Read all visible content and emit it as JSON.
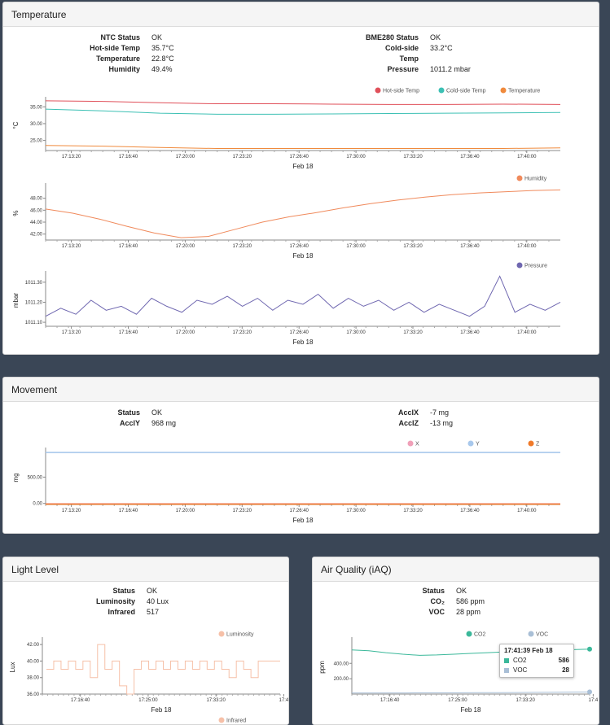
{
  "temperature": {
    "title": "Temperature",
    "status_left": [
      {
        "k": "NTC Status",
        "v": "OK"
      },
      {
        "k": "Hot-side Temp",
        "v": "35.7°C"
      },
      {
        "k": "Temperature",
        "v": "22.8°C"
      },
      {
        "k": "Humidity",
        "v": "49.4%"
      }
    ],
    "status_right": [
      {
        "k": "BME280 Status",
        "v": "OK"
      },
      {
        "k": "Cold-side Temp",
        "v": "33.2°C"
      },
      {
        "k": "Pressure",
        "v": "1011.2 mbar"
      }
    ]
  },
  "movement": {
    "title": "Movement",
    "status_left": [
      {
        "k": "Status",
        "v": "OK"
      },
      {
        "k": "AcclY",
        "v": "968 mg"
      }
    ],
    "status_right": [
      {
        "k": "AcclX",
        "v": "-7 mg"
      },
      {
        "k": "AcclZ",
        "v": "-13 mg"
      }
    ]
  },
  "light": {
    "title": "Light Level",
    "status": [
      {
        "k": "Status",
        "v": "OK"
      },
      {
        "k": "Luminosity",
        "v": "40 Lux"
      },
      {
        "k": "Infrared",
        "v": "517"
      }
    ]
  },
  "air": {
    "title": "Air Quality (iAQ)",
    "status": [
      {
        "k": "Status",
        "v": "OK"
      },
      {
        "k": "CO₂",
        "v": "586 ppm"
      },
      {
        "k": "VOC",
        "v": "28 ppm"
      }
    ],
    "tooltip": {
      "time": "17:41:39  Feb 18",
      "rows": [
        {
          "name": "CO2",
          "value": "586",
          "color": "#3bb89a"
        },
        {
          "name": "VOC",
          "value": "28",
          "color": "#a9bfd6"
        }
      ]
    }
  },
  "chart_data": [
    {
      "id": "temp",
      "type": "line",
      "ylabel": "°C",
      "xlabel": "Feb 18",
      "x": [
        "17:13:20",
        "17:16:40",
        "17:20:00",
        "17:23:20",
        "17:26:40",
        "17:30:00",
        "17:33:20",
        "17:36:40",
        "17:40:00"
      ],
      "yticks": [
        "35.00",
        "30.00",
        "25.00"
      ],
      "ylim": [
        22,
        37
      ],
      "legend": "top-right",
      "series": [
        {
          "name": "Hot-side Temp",
          "color": "#e0505a",
          "values": [
            36.8,
            36.6,
            36.2,
            35.9,
            35.9,
            35.8,
            35.7,
            35.7,
            35.8,
            35.7
          ]
        },
        {
          "name": "Cold-side Temp",
          "color": "#3cc0b4",
          "values": [
            34.3,
            33.8,
            33.1,
            32.8,
            32.8,
            32.9,
            33.0,
            33.1,
            33.2,
            33.3
          ]
        },
        {
          "name": "Temperature",
          "color": "#f08a3c",
          "values": [
            23.5,
            23.3,
            22.9,
            22.6,
            22.6,
            22.6,
            22.6,
            22.6,
            22.6,
            22.8
          ]
        }
      ]
    },
    {
      "id": "hum",
      "type": "line",
      "ylabel": "%",
      "xlabel": "Feb 18",
      "x": [
        "17:13:20",
        "17:16:40",
        "17:20:00",
        "17:23:20",
        "17:26:40",
        "17:30:00",
        "17:33:20",
        "17:36:40",
        "17:40:00"
      ],
      "yticks": [
        "48.00",
        "46.00",
        "44.00",
        "42.00"
      ],
      "ylim": [
        41,
        50
      ],
      "legend": "top-right",
      "series": [
        {
          "name": "Humidity",
          "color": "#f08a5c",
          "values": [
            46.2,
            45.5,
            44.5,
            43.3,
            42.2,
            41.4,
            41.6,
            42.8,
            44.0,
            44.9,
            45.6,
            46.4,
            47.1,
            47.7,
            48.2,
            48.6,
            48.9,
            49.1,
            49.3,
            49.4
          ]
        }
      ]
    },
    {
      "id": "pres",
      "type": "line",
      "ylabel": "mbar",
      "xlabel": "Feb 18",
      "x": [
        "17:13:20",
        "17:16:40",
        "17:20:00",
        "17:23:20",
        "17:26:40",
        "17:30:00",
        "17:33:20",
        "17:36:40",
        "17:40:00"
      ],
      "yticks": [
        "1011.30",
        "1011.20",
        "1011.10"
      ],
      "ylim": [
        1011.08,
        1011.34
      ],
      "legend": "top-right",
      "series": [
        {
          "name": "Pressure",
          "color": "#6f67b0",
          "values": [
            1011.13,
            1011.17,
            1011.14,
            1011.21,
            1011.16,
            1011.18,
            1011.14,
            1011.22,
            1011.18,
            1011.15,
            1011.21,
            1011.19,
            1011.23,
            1011.18,
            1011.22,
            1011.16,
            1011.21,
            1011.19,
            1011.24,
            1011.17,
            1011.22,
            1011.18,
            1011.21,
            1011.16,
            1011.2,
            1011.15,
            1011.19,
            1011.16,
            1011.13,
            1011.18,
            1011.33,
            1011.15,
            1011.19,
            1011.16,
            1011.2
          ]
        }
      ]
    },
    {
      "id": "mov",
      "type": "line",
      "ylabel": "mg",
      "xlabel": "Feb 18",
      "x": [
        "17:13:20",
        "17:16:40",
        "17:20:00",
        "17:23:20",
        "17:26:40",
        "17:30:00",
        "17:33:20",
        "17:36:40",
        "17:40:00"
      ],
      "yticks": [
        "500.00",
        "0.00"
      ],
      "ylim": [
        -20,
        1000
      ],
      "legend": "top-right",
      "series": [
        {
          "name": "X",
          "color": "#f0a0b8",
          "values": [
            -7,
            -7
          ]
        },
        {
          "name": "Y",
          "color": "#a8c8ec",
          "values": [
            968,
            968
          ]
        },
        {
          "name": "Z",
          "color": "#f07a2a",
          "values": [
            -13,
            -13
          ]
        }
      ]
    },
    {
      "id": "lux",
      "type": "line",
      "ylabel": "Lux",
      "xlabel": "Feb 18",
      "x": [
        "17:16:40",
        "17:25:00",
        "17:33:20",
        "17:4"
      ],
      "yticks": [
        "42.00",
        "40.00",
        "38.00",
        "36.00"
      ],
      "ylim": [
        36,
        42.5
      ],
      "legend": "top-right",
      "series": [
        {
          "name": "Luminosity",
          "color": "#f6c0a8",
          "values": [
            39,
            40,
            39,
            40,
            39,
            40,
            38,
            42,
            39,
            40,
            37,
            36,
            39,
            40,
            39,
            40,
            39,
            40,
            39,
            40,
            39,
            40,
            39,
            40,
            39,
            38,
            40,
            39,
            38,
            40,
            40,
            40
          ]
        },
        {
          "name": "Infrared",
          "color": "#f6c0a8",
          "values": []
        }
      ]
    },
    {
      "id": "aiq",
      "type": "line",
      "ylabel": "ppm",
      "xlabel": "Feb 18",
      "x": [
        "17:16:40",
        "17:25:00",
        "17:33:20",
        "17:4"
      ],
      "yticks": [
        "400.00",
        "200.00"
      ],
      "ylim": [
        0,
        700
      ],
      "legend": "top-right",
      "series": [
        {
          "name": "CO2",
          "color": "#3bb89a",
          "values": [
            575,
            565,
            540,
            520,
            505,
            510,
            520,
            530,
            540,
            550,
            560,
            570,
            575,
            580,
            586
          ]
        },
        {
          "name": "VOC",
          "color": "#a9bfd6",
          "values": [
            15,
            15,
            15,
            15,
            16,
            16,
            17,
            18,
            18,
            20,
            22,
            24,
            26,
            28
          ]
        }
      ]
    }
  ]
}
